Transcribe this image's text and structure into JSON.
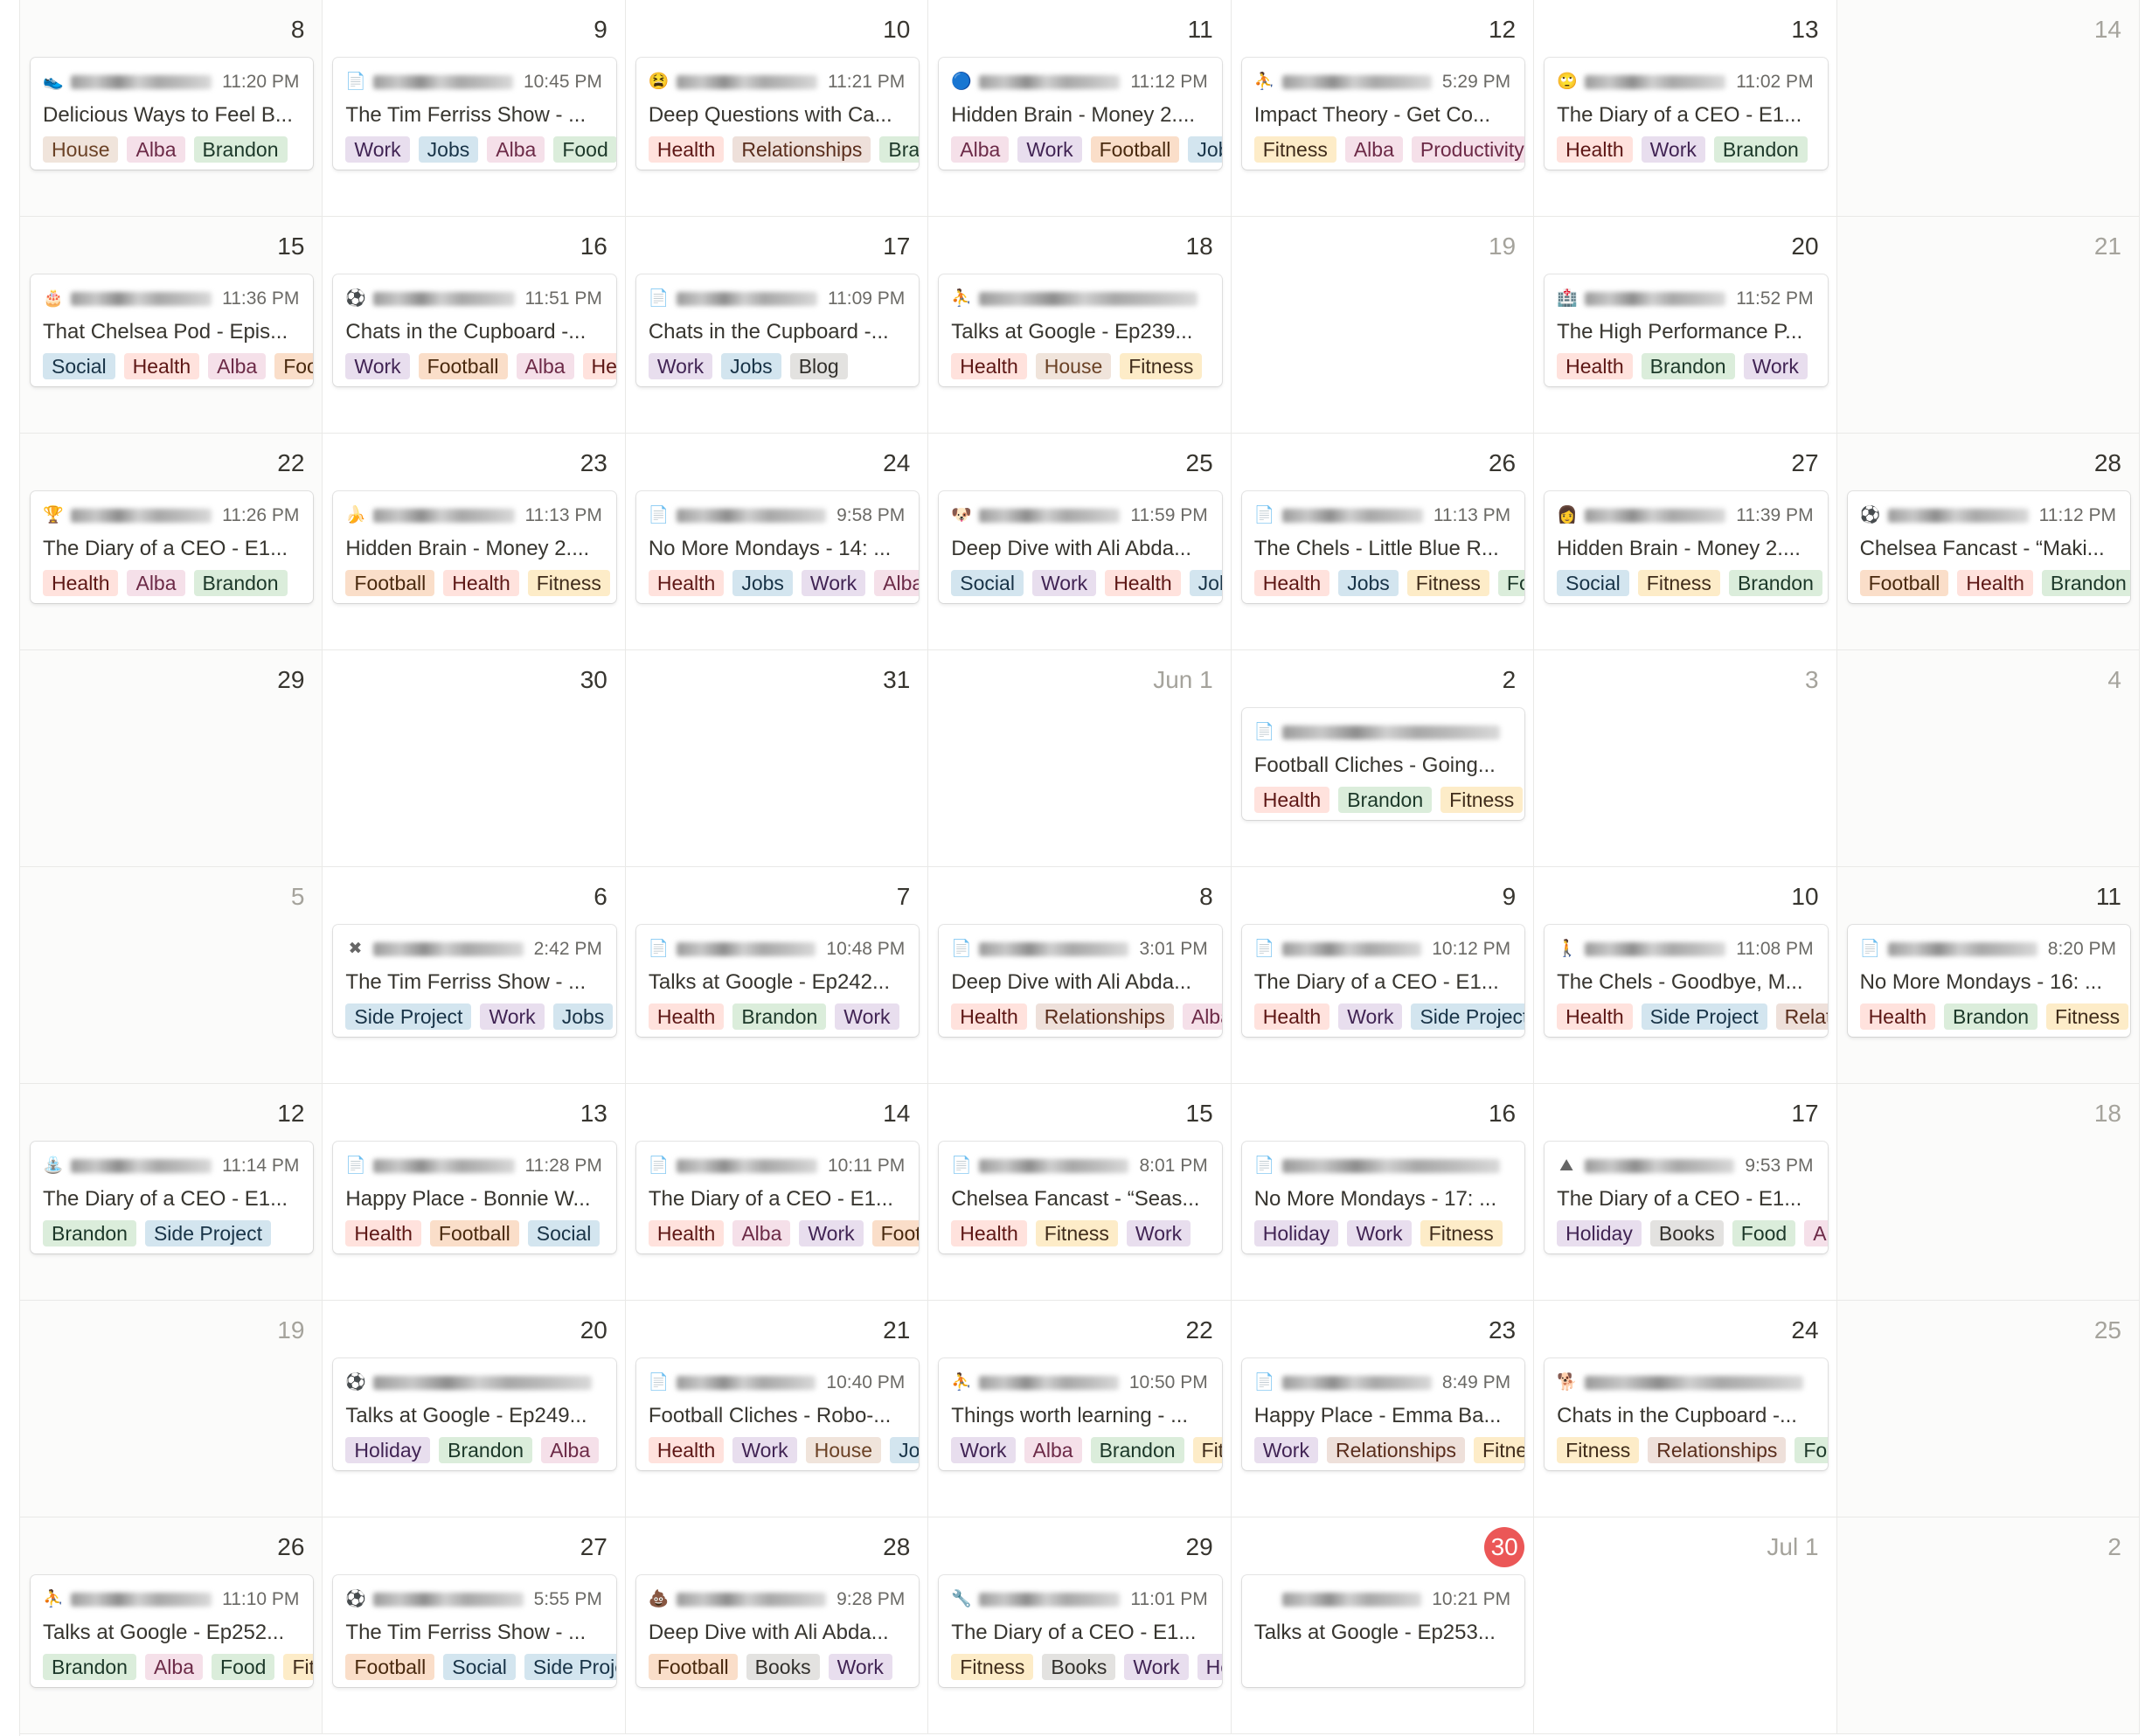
{
  "tag_colors": {
    "House": [
      "#f0e4db",
      "#6b4226"
    ],
    "Alba": [
      "#f5e0e9",
      "#6c2a47"
    ],
    "Brandon": [
      "#dbeddb",
      "#1c3829"
    ],
    "Work": [
      "#e8deee",
      "#412454"
    ],
    "Jobs": [
      "#d3e5ef",
      "#183347"
    ],
    "Food": [
      "#dbeddb",
      "#1c3829"
    ],
    "Health": [
      "#ffe2dd",
      "#5d1715"
    ],
    "Relationships": [
      "#eee0da",
      "#5a2e1d"
    ],
    "Football": [
      "#fadec9",
      "#49290e"
    ],
    "Fitness": [
      "#fdecc8",
      "#402c1b"
    ],
    "Productivity": [
      "#f5e0e9",
      "#6c2a47"
    ],
    "Social": [
      "#d3e5ef",
      "#183347"
    ],
    "Blog": [
      "#e3e2e0",
      "#32302c"
    ],
    "Side Project": [
      "#d3e5ef",
      "#183347"
    ],
    "Holiday": [
      "#e8deee",
      "#412454"
    ],
    "Books": [
      "#e3e2e0",
      "#32302c"
    ]
  },
  "days": [
    {
      "day": "8"
    },
    {
      "day": "9"
    },
    {
      "day": "10"
    },
    {
      "day": "11"
    },
    {
      "day": "12"
    },
    {
      "day": "13"
    },
    {
      "day": "14"
    },
    {
      "day": "15"
    },
    {
      "day": "16"
    },
    {
      "day": "17"
    },
    {
      "day": "18"
    },
    {
      "day": "19"
    },
    {
      "day": "20"
    },
    {
      "day": "21"
    },
    {
      "day": "22"
    },
    {
      "day": "23"
    },
    {
      "day": "24"
    },
    {
      "day": "25"
    },
    {
      "day": "26"
    },
    {
      "day": "27"
    },
    {
      "day": "28"
    },
    {
      "day": "29"
    },
    {
      "day": "30"
    },
    {
      "day": "31"
    },
    {
      "day": "Jun 1"
    },
    {
      "day": "2"
    },
    {
      "day": "3"
    },
    {
      "day": "4"
    },
    {
      "day": "5"
    },
    {
      "day": "6"
    },
    {
      "day": "7"
    },
    {
      "day": "8"
    },
    {
      "day": "9"
    },
    {
      "day": "10"
    },
    {
      "day": "11"
    },
    {
      "day": "12"
    },
    {
      "day": "13"
    },
    {
      "day": "14"
    },
    {
      "day": "15"
    },
    {
      "day": "16"
    },
    {
      "day": "17"
    },
    {
      "day": "18"
    },
    {
      "day": "19"
    },
    {
      "day": "20"
    },
    {
      "day": "21"
    },
    {
      "day": "22"
    },
    {
      "day": "23"
    },
    {
      "day": "24"
    },
    {
      "day": "25"
    },
    {
      "day": "26"
    },
    {
      "day": "27"
    },
    {
      "day": "28"
    },
    {
      "day": "29"
    },
    {
      "day": "30"
    },
    {
      "day": "Jul 1"
    },
    {
      "day": "2"
    }
  ],
  "events": [
    {
      "cell": 0,
      "icon": "👟",
      "time": "11:20 PM",
      "title": "Delicious Ways to Feel B...",
      "tags": [
        "House",
        "Alba",
        "Brandon"
      ]
    },
    {
      "cell": 1,
      "icon": "📄",
      "time": "10:45 PM",
      "title": "The Tim Ferriss Show - ...",
      "tags": [
        "Work",
        "Jobs",
        "Alba",
        "Food"
      ]
    },
    {
      "cell": 2,
      "icon": "😫",
      "time": "11:21 PM",
      "title": "Deep Questions with Ca...",
      "tags": [
        "Health",
        "Relationships",
        "Brandon"
      ]
    },
    {
      "cell": 3,
      "icon": "🔵",
      "time": "11:12 PM",
      "title": "Hidden Brain - Money 2....",
      "tags": [
        "Alba",
        "Work",
        "Football",
        "Jobs"
      ]
    },
    {
      "cell": 4,
      "icon": "⛹",
      "time": "5:29 PM",
      "title": "Impact Theory - Get Co...",
      "tags": [
        "Fitness",
        "Alba",
        "Productivity"
      ]
    },
    {
      "cell": 5,
      "icon": "🙄",
      "time": "11:02 PM",
      "title": "The Diary of a CEO - E1...",
      "tags": [
        "Health",
        "Work",
        "Brandon"
      ]
    },
    {
      "cell": 7,
      "icon": "🎂",
      "time": "11:36 PM",
      "title": "That Chelsea Pod - Epis...",
      "tags": [
        "Social",
        "Health",
        "Alba",
        "Football"
      ]
    },
    {
      "cell": 8,
      "icon": "⚽",
      "time": "11:51 PM",
      "title": "Chats in the Cupboard -...",
      "tags": [
        "Work",
        "Football",
        "Alba",
        "Health"
      ]
    },
    {
      "cell": 9,
      "icon": "📄",
      "time": "11:09 PM",
      "title": "Chats in the Cupboard -...",
      "tags": [
        "Work",
        "Jobs",
        "Blog"
      ]
    },
    {
      "cell": 10,
      "icon": "⛹",
      "time": "",
      "title": "Talks at Google - Ep239...",
      "tags": [
        "Health",
        "House",
        "Fitness"
      ]
    },
    {
      "cell": 12,
      "icon": "🏥",
      "time": "11:52 PM",
      "title": "The High Performance P...",
      "tags": [
        "Health",
        "Brandon",
        "Work"
      ]
    },
    {
      "cell": 14,
      "icon": "🏆",
      "time": "11:26 PM",
      "title": "The Diary of a CEO - E1...",
      "tags": [
        "Health",
        "Alba",
        "Brandon"
      ]
    },
    {
      "cell": 15,
      "icon": "🍌",
      "time": "11:13 PM",
      "title": "Hidden Brain - Money 2....",
      "tags": [
        "Football",
        "Health",
        "Fitness"
      ]
    },
    {
      "cell": 16,
      "icon": "📄",
      "time": "9:58 PM",
      "title": "No More Mondays - 14: ...",
      "tags": [
        "Health",
        "Jobs",
        "Work",
        "Alba"
      ]
    },
    {
      "cell": 17,
      "icon": "🐶",
      "time": "11:59 PM",
      "title": "Deep Dive with Ali Abda...",
      "tags": [
        "Social",
        "Work",
        "Health",
        "Jobs"
      ]
    },
    {
      "cell": 18,
      "icon": "📄",
      "time": "11:13 PM",
      "title": "The Chels - Little Blue R...",
      "tags": [
        "Health",
        "Jobs",
        "Fitness",
        "Food"
      ]
    },
    {
      "cell": 19,
      "icon": "👩",
      "time": "11:39 PM",
      "title": "Hidden Brain - Money 2....",
      "tags": [
        "Social",
        "Fitness",
        "Brandon"
      ]
    },
    {
      "cell": 20,
      "icon": "⚽",
      "time": "11:12 PM",
      "title": "Chelsea Fancast - “Maki...",
      "tags": [
        "Football",
        "Health",
        "Brandon"
      ]
    },
    {
      "cell": 25,
      "icon": "📄",
      "time": "",
      "title": "Football Cliches - Going...",
      "tags": [
        "Health",
        "Brandon",
        "Fitness"
      ]
    },
    {
      "cell": 29,
      "icon": "✖",
      "time": "2:42 PM",
      "title": "The Tim Ferriss Show - ...",
      "tags": [
        "Side Project",
        "Work",
        "Jobs"
      ]
    },
    {
      "cell": 30,
      "icon": "📄",
      "time": "10:48 PM",
      "title": "Talks at Google - Ep242...",
      "tags": [
        "Health",
        "Brandon",
        "Work"
      ]
    },
    {
      "cell": 31,
      "icon": "📄",
      "time": "3:01 PM",
      "title": "Deep Dive with Ali Abda...",
      "tags": [
        "Health",
        "Relationships",
        "Alba"
      ]
    },
    {
      "cell": 32,
      "icon": "📄",
      "time": "10:12 PM",
      "title": "The Diary of a CEO - E1...",
      "tags": [
        "Health",
        "Work",
        "Side Project"
      ]
    },
    {
      "cell": 33,
      "icon": "🚶",
      "time": "11:08 PM",
      "title": "The Chels - Goodbye, M...",
      "tags": [
        "Health",
        "Side Project",
        "Relationships"
      ]
    },
    {
      "cell": 34,
      "icon": "📄",
      "time": "8:20 PM",
      "title": "No More Mondays - 16: ...",
      "tags": [
        "Health",
        "Brandon",
        "Fitness"
      ]
    },
    {
      "cell": 35,
      "icon": "⛲",
      "time": "11:14 PM",
      "title": "The Diary of a CEO - E1...",
      "tags": [
        "Brandon",
        "Side Project"
      ]
    },
    {
      "cell": 36,
      "icon": "📄",
      "time": "11:28 PM",
      "title": "Happy Place - Bonnie W...",
      "tags": [
        "Health",
        "Football",
        "Social"
      ]
    },
    {
      "cell": 37,
      "icon": "📄",
      "time": "10:11 PM",
      "title": "The Diary of a CEO - E1...",
      "tags": [
        "Health",
        "Alba",
        "Work",
        "Football"
      ]
    },
    {
      "cell": 38,
      "icon": "📄",
      "time": "8:01 PM",
      "title": "Chelsea Fancast - “Seas...",
      "tags": [
        "Health",
        "Fitness",
        "Work"
      ]
    },
    {
      "cell": 39,
      "icon": "📄",
      "time": "",
      "title": "No More Mondays - 17: ...",
      "tags": [
        "Holiday",
        "Work",
        "Fitness"
      ]
    },
    {
      "cell": 40,
      "icon": "⛰",
      "time": "9:53 PM",
      "title": "The Diary of a CEO - E1...",
      "tags": [
        "Holiday",
        "Books",
        "Food",
        "Alba"
      ]
    },
    {
      "cell": 43,
      "icon": "⚽",
      "time": "",
      "title": "Talks at Google - Ep249...",
      "tags": [
        "Holiday",
        "Brandon",
        "Alba"
      ]
    },
    {
      "cell": 44,
      "icon": "📄",
      "time": "10:40 PM",
      "title": "Football Cliches - Robo-...",
      "tags": [
        "Health",
        "Work",
        "House",
        "Jobs"
      ]
    },
    {
      "cell": 45,
      "icon": "⛹",
      "time": "10:50 PM",
      "title": "Things worth learning - ...",
      "tags": [
        "Work",
        "Alba",
        "Brandon",
        "Fitness"
      ]
    },
    {
      "cell": 46,
      "icon": "📄",
      "time": "8:49 PM",
      "title": "Happy Place - Emma Ba...",
      "tags": [
        "Work",
        "Relationships",
        "Fitness"
      ]
    },
    {
      "cell": 47,
      "icon": "🐕",
      "time": "",
      "title": "Chats in the Cupboard -...",
      "tags": [
        "Fitness",
        "Relationships",
        "Food"
      ]
    },
    {
      "cell": 49,
      "icon": "⛹",
      "time": "11:10 PM",
      "title": "Talks at Google - Ep252...",
      "tags": [
        "Brandon",
        "Alba",
        "Food",
        "Fitness"
      ]
    },
    {
      "cell": 50,
      "icon": "⚽",
      "time": "5:55 PM",
      "title": "The Tim Ferriss Show - ...",
      "tags": [
        "Football",
        "Social",
        "Side Project"
      ]
    },
    {
      "cell": 51,
      "icon": "💩",
      "time": "9:28 PM",
      "title": "Deep Dive with Ali Abda...",
      "tags": [
        "Football",
        "Books",
        "Work"
      ]
    },
    {
      "cell": 52,
      "icon": "🔧",
      "time": "11:01 PM",
      "title": "The Diary of a CEO - E1...",
      "tags": [
        "Fitness",
        "Books",
        "Work",
        "Holiday"
      ]
    },
    {
      "cell": 53,
      "icon": "",
      "time": "10:21 PM",
      "title": "Talks at Google - Ep253...",
      "tags": []
    }
  ]
}
